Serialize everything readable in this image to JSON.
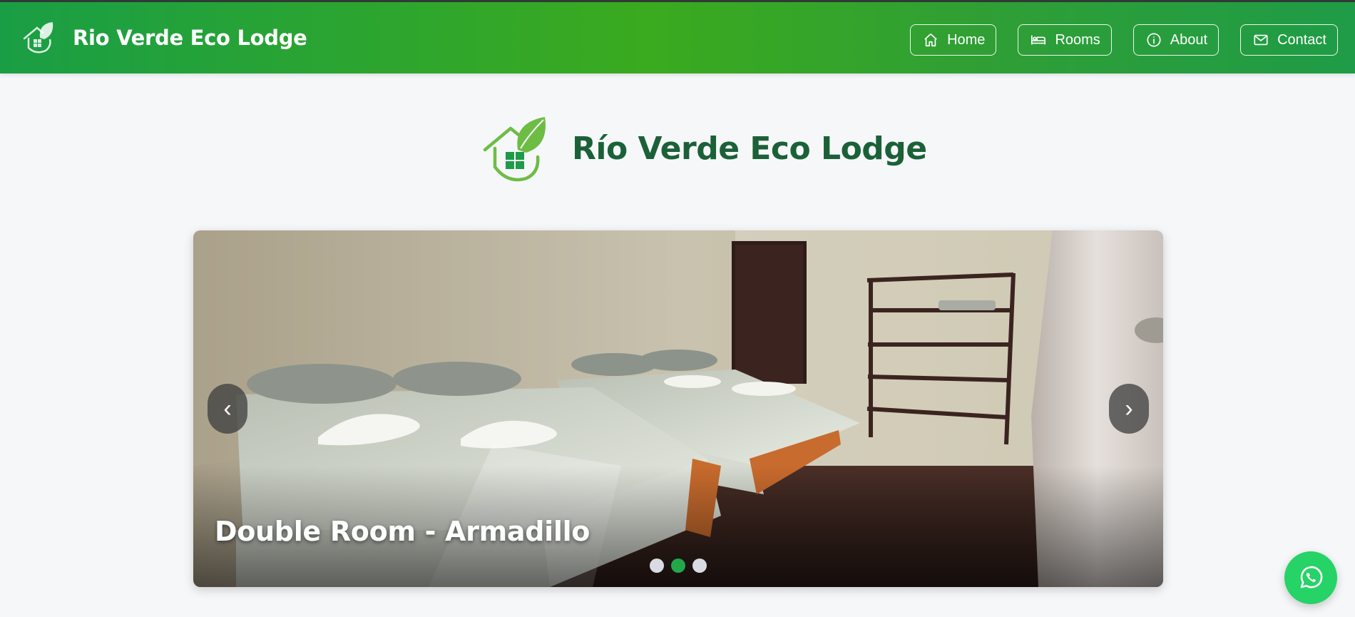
{
  "header": {
    "brand_name": "Rio Verde Eco Lodge",
    "logo_icon": "house-leaf-icon",
    "nav": [
      {
        "label": "Home",
        "icon": "home-icon"
      },
      {
        "label": "Rooms",
        "icon": "bed-icon"
      },
      {
        "label": "About",
        "icon": "info-icon"
      },
      {
        "label": "Contact",
        "icon": "envelope-icon"
      }
    ],
    "colors": {
      "bar_start": "#1a9e45",
      "bar_mid": "#3aaa1f",
      "text": "#ffffff"
    }
  },
  "hero": {
    "title": "Río Verde Eco Lodge",
    "logo_icon": "house-leaf-icon",
    "title_color": "#1b6137"
  },
  "carousel": {
    "caption": "Double Room - Armadillo",
    "prev_label": "‹",
    "next_label": "›",
    "slide_count": 3,
    "active_index": 1,
    "active_dot_color": "#22a84a"
  },
  "whatsapp": {
    "icon": "whatsapp-icon",
    "color": "#25d366"
  }
}
